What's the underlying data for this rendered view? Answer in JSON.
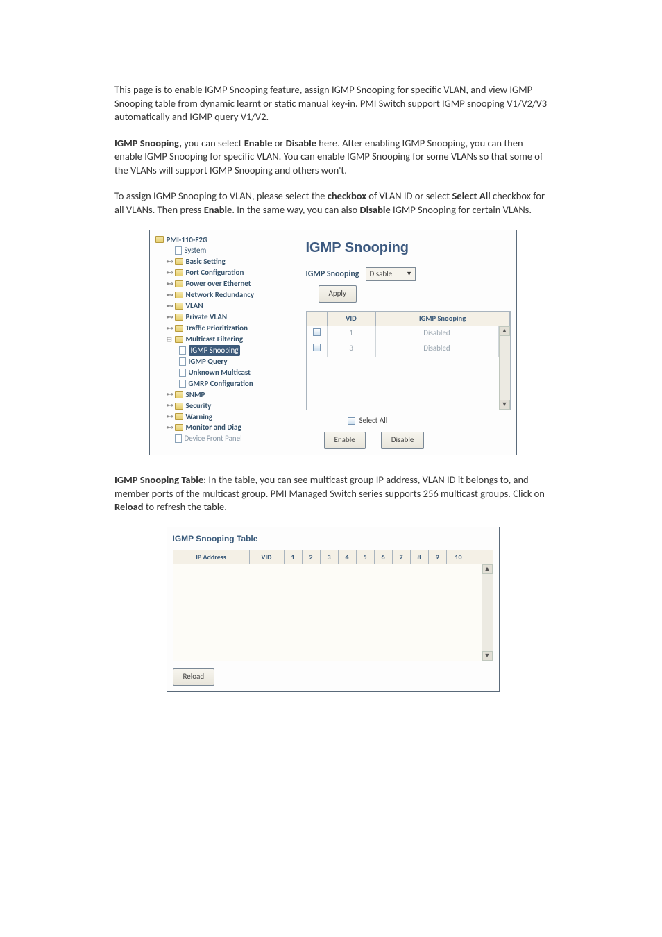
{
  "paragraphs": {
    "p1": "This page is to enable IGMP Snooping feature, assign IGMP Snooping for specific VLAN, and view IGMP Snooping table from dynamic learnt or static manual key-in. PMI Switch support IGMP snooping V1/V2/V3 automatically and IGMP query V1/V2.",
    "p2_prefix": "IGMP Snooping,",
    "p2_mid1": " you can select ",
    "p2_enable": "Enable",
    "p2_mid2": " or ",
    "p2_disable": "Disable",
    "p2_rest": " here. After enabling IGMP Snooping, you can then enable IGMP Snooping for specific VLAN. You can enable IGMP Snooping for some VLANs so that some of the VLANs will support IGMP Snooping and others won't.",
    "p3_a": "To assign IGMP Snooping to VLAN, please select the ",
    "p3_checkbox": "checkbox",
    "p3_b": " of VLAN ID or select ",
    "p3_selectall": "Select All",
    "p3_c": " checkbox for all VLANs. Then press ",
    "p3_enable": "Enable",
    "p3_d": ". In the same way, you can also ",
    "p3_disable": "Disable",
    "p3_e": " IGMP Snooping for certain VLANs.",
    "p4_a": "IGMP Snooping Table",
    "p4_b": ": In the table, you can see multicast group IP address, VLAN ID it belongs to, and member ports of the multicast group. PMI Managed Switch series supports 256 multicast groups. Click on ",
    "p4_reload": "Reload",
    "p4_c": " to refresh the table."
  },
  "tree": {
    "root": "PMI-110-F2G",
    "items": [
      {
        "label": "System",
        "icon": "page"
      },
      {
        "label": "Basic Setting",
        "icon": "folder",
        "bold": true
      },
      {
        "label": "Port Configuration",
        "icon": "folder",
        "bold": true
      },
      {
        "label": "Power over Ethernet",
        "icon": "folder",
        "bold": true
      },
      {
        "label": "Network Redundancy",
        "icon": "folder",
        "bold": true
      },
      {
        "label": "VLAN",
        "icon": "folder",
        "bold": true
      },
      {
        "label": "Private VLAN",
        "icon": "folder",
        "bold": true
      },
      {
        "label": "Traffic Prioritization",
        "icon": "folder",
        "bold": true
      },
      {
        "label": "Multicast Filtering",
        "icon": "folder",
        "bold": true,
        "expanded": true
      },
      {
        "label": "SNMP",
        "icon": "folder",
        "bold": true
      },
      {
        "label": "Security",
        "icon": "folder",
        "bold": true
      },
      {
        "label": "Warning",
        "icon": "folder",
        "bold": true
      },
      {
        "label": "Monitor and Diag",
        "icon": "folder",
        "bold": true
      },
      {
        "label": "Device Front Panel",
        "icon": "page",
        "muted": true
      }
    ],
    "mcast_children": [
      {
        "label": "IGMP Snooping",
        "selected": true
      },
      {
        "label": "IGMP Query"
      },
      {
        "label": "Unknown Multicast"
      },
      {
        "label": "GMRP Configuration"
      }
    ]
  },
  "panel": {
    "title": "IGMP Snooping",
    "field_label": "IGMP Snooping",
    "select_value": "Disable",
    "apply": "Apply",
    "col_vid": "VID",
    "col_snoop": "IGMP Snooping",
    "rows": [
      {
        "vid": "1",
        "status": "Disabled"
      },
      {
        "vid": "3",
        "status": "Disabled"
      }
    ],
    "select_all": "Select All",
    "enable_btn": "Enable",
    "disable_btn": "Disable"
  },
  "table2": {
    "title": "IGMP Snooping Table",
    "ip": "IP Address",
    "vid": "VID",
    "cols": [
      "1",
      "2",
      "3",
      "4",
      "5",
      "6",
      "7",
      "8",
      "9",
      "10"
    ],
    "reload": "Reload"
  }
}
